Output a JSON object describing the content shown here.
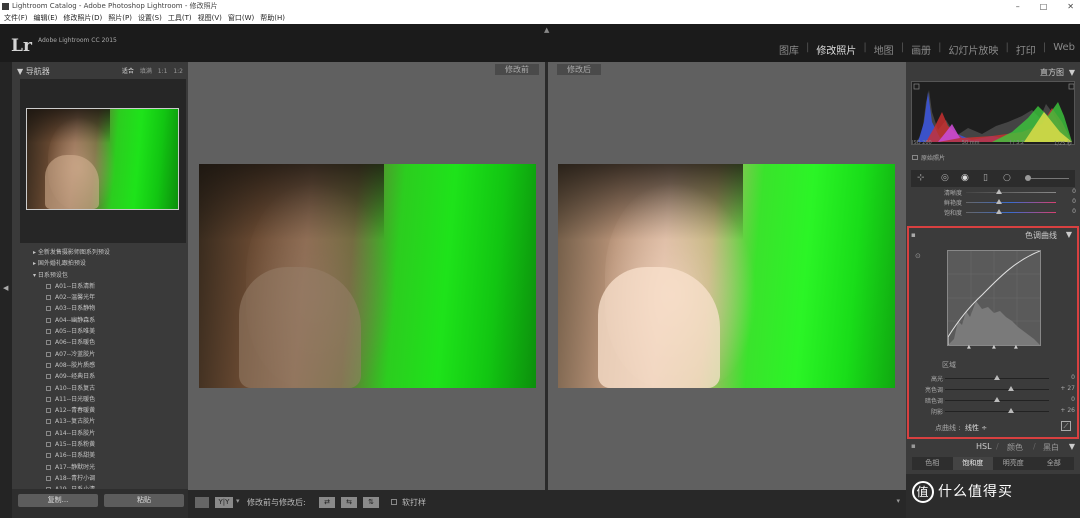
{
  "window": {
    "title": "Lightroom Catalog - Adobe Photoshop Lightroom - 修改照片",
    "controls": [
      "–",
      "□",
      "✕"
    ]
  },
  "menu": [
    "文件(F)",
    "编辑(E)",
    "修改照片(D)",
    "照片(P)",
    "设置(S)",
    "工具(T)",
    "视图(V)",
    "窗口(W)",
    "帮助(H)"
  ],
  "app": {
    "logo": "Lr",
    "version": "Adobe Lightroom CC 2015"
  },
  "modules": [
    {
      "label": "图库",
      "active": false
    },
    {
      "label": "修改照片",
      "active": true
    },
    {
      "label": "地图",
      "active": false
    },
    {
      "label": "画册",
      "active": false
    },
    {
      "label": "幻灯片放映",
      "active": false
    },
    {
      "label": "打印",
      "active": false
    },
    {
      "label": "Web",
      "active": false
    }
  ],
  "navigator": {
    "title": "导航器",
    "zooms": [
      "适合",
      "填满",
      "1:1",
      "1:2"
    ],
    "active_zoom": "适合"
  },
  "presets": {
    "folders": [
      "全新发售摄影师图系列预设",
      "国外婚礼跟拍预设",
      "日系预设包"
    ],
    "items": [
      "A01--日系清新",
      "A02--温馨光年",
      "A03--日系静物",
      "A04--幽静森系",
      "A05--日系唯美",
      "A06--日系暖色",
      "A07--冷蓝胶片",
      "A08--胶片质感",
      "A09--经典日系",
      "A10--日系复古",
      "A11--日光暖色",
      "A12--青春暖黄",
      "A13--复古胶片",
      "A14--日系胶片",
      "A15--日系粉黄",
      "A16--日系甜美",
      "A17--静默时光",
      "A18--青柠小调",
      "A19--日系小清"
    ]
  },
  "left_buttons": {
    "copy": "复制...",
    "paste": "粘贴"
  },
  "compare": {
    "before": "修改前",
    "after": "修改后"
  },
  "toolbar": {
    "yy": "Y|Y",
    "label": "修改前与修改后:",
    "softproof": "软打样"
  },
  "histogram": {
    "title": "直方图",
    "iso": "ISO 200",
    "focal": "50 mm",
    "aperture": "f / 3.2",
    "shutter": "1/25 秒",
    "original_label": "原始照片"
  },
  "basic_rows": [
    {
      "label": "清晰度",
      "value": "0",
      "pos": 0.5
    },
    {
      "label": "鲜艳度",
      "value": "0",
      "pos": 0.5
    },
    {
      "label": "饱和度",
      "value": "0",
      "pos": 0.5
    }
  ],
  "tone_curve": {
    "title": "色调曲线",
    "region": "区域",
    "sliders": [
      {
        "label": "高光",
        "value": "0",
        "pos": 0.5
      },
      {
        "label": "亮色调",
        "value": "+ 27",
        "pos": 0.63
      },
      {
        "label": "暗色调",
        "value": "0",
        "pos": 0.5
      },
      {
        "label": "阴影",
        "value": "+ 26",
        "pos": 0.63
      }
    ],
    "point_curve_label": "点曲线 :",
    "point_curve_value": "线性 ÷"
  },
  "hsl": {
    "head": "HSL",
    "color": "颜色",
    "bw": "黑白",
    "tabs": [
      "色相",
      "饱和度",
      "明亮度",
      "全部"
    ],
    "active": "饱和度"
  },
  "watermark": {
    "text": "值 什么值得买",
    "symbol": "值"
  },
  "colors": {
    "accent_red": "#d84040",
    "green": "#1ee31a"
  }
}
